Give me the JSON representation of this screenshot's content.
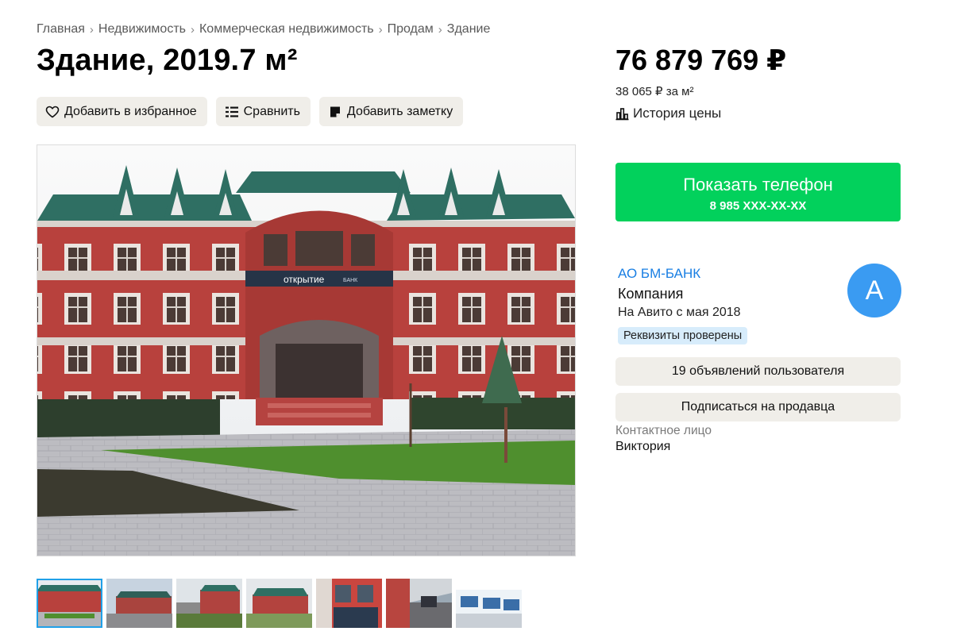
{
  "breadcrumb": [
    "Главная",
    "Недвижимость",
    "Коммерческая недвижимость",
    "Продам",
    "Здание"
  ],
  "breadcrumb_separator": "›",
  "title": "Здание, 2019.7 м²",
  "actions": {
    "favorite": "Добавить в избранное",
    "compare": "Сравнить",
    "note": "Добавить заметку"
  },
  "price": {
    "value": "76 879 769 ₽",
    "per_m2": "38 065 ₽ за м²",
    "history": "История цены"
  },
  "phone_button": {
    "label": "Показать телефон",
    "number": "8 985 XXX-XX-XX"
  },
  "seller": {
    "name": "АО БМ-БАНК",
    "type": "Компания",
    "since": "На Авито с мая 2018",
    "badge": "Реквизиты проверены",
    "avatar_letter": "А",
    "ads_button": "19 объявлений пользователя",
    "subscribe_button": "Подписаться на продавца"
  },
  "contact": {
    "label": "Контактное лицо",
    "name": "Виктория"
  },
  "photo": {
    "sign_text": "открытие",
    "sign_sub": "БАНК"
  },
  "colors": {
    "accent_green": "#02d15c",
    "link_blue": "#1a7fe3",
    "avatar_blue": "#3a9bf2",
    "badge_blue": "#d7ecfb",
    "button_gray": "#f0eee9"
  }
}
